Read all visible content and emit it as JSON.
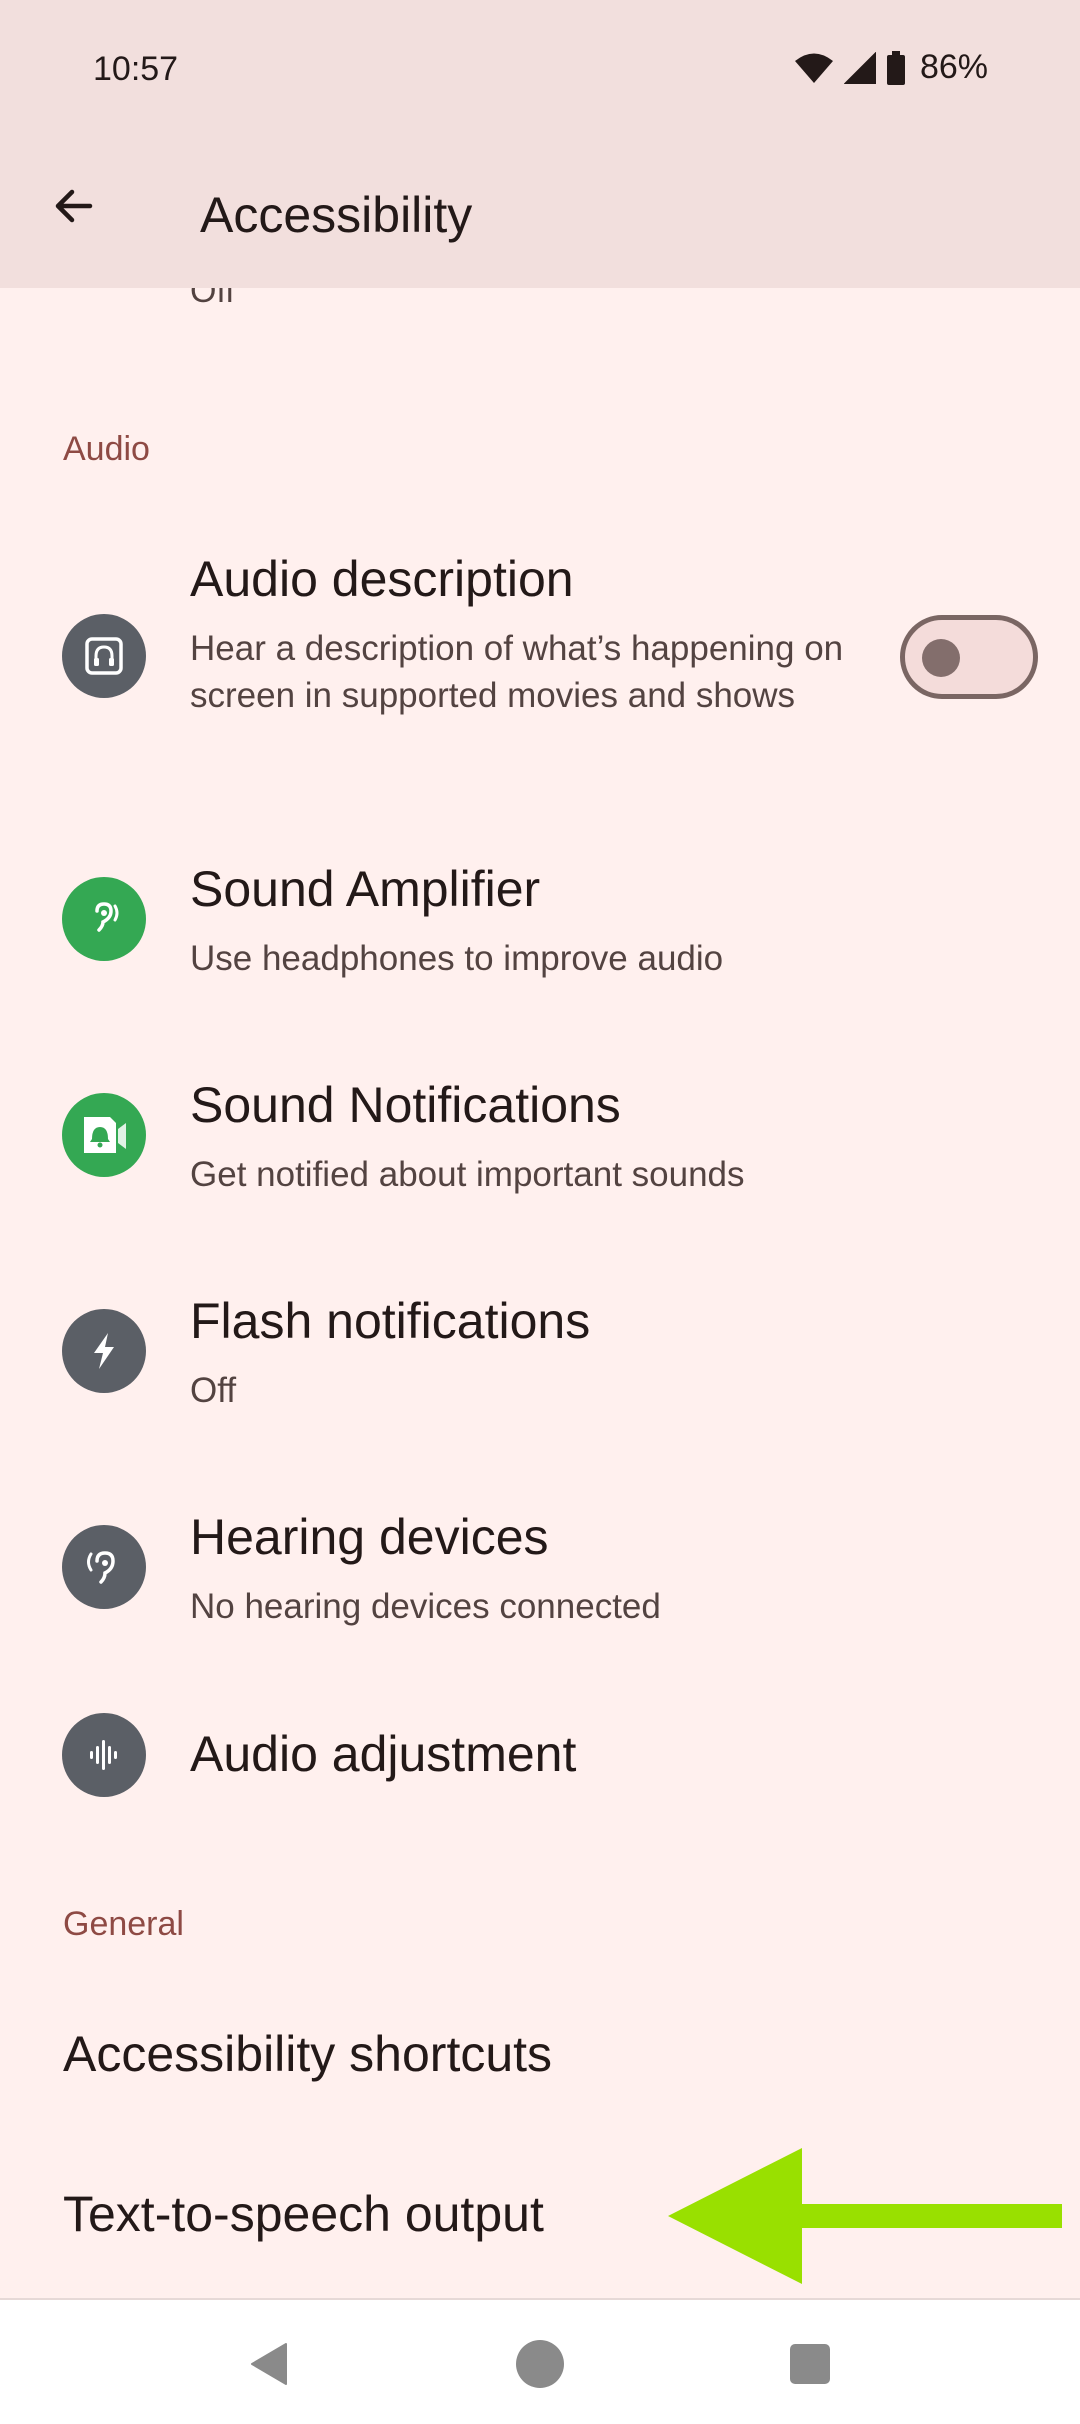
{
  "status_bar": {
    "time": "10:57",
    "battery": "86%",
    "icons": [
      "wifi-icon",
      "signal-icon",
      "battery-icon"
    ]
  },
  "app_bar": {
    "title": "Accessibility",
    "back_icon": "arrow-left-icon"
  },
  "partial_item": {
    "subtitle": "Off"
  },
  "sections": {
    "audio": "Audio",
    "general": "General"
  },
  "audio_items": [
    {
      "title": "Audio description",
      "subtitle": "Hear a description of what’s happening on screen in supported movies and shows",
      "icon": "audio-description-icon",
      "toggle": false
    },
    {
      "title": "Sound Amplifier",
      "subtitle": "Use headphones to improve audio",
      "icon": "sound-amplifier-icon"
    },
    {
      "title": "Sound Notifications",
      "subtitle": "Get notified about important sounds",
      "icon": "sound-notifications-icon"
    },
    {
      "title": "Flash notifications",
      "subtitle": "Off",
      "icon": "flash-icon"
    },
    {
      "title": "Hearing devices",
      "subtitle": "No hearing devices connected",
      "icon": "hearing-icon"
    },
    {
      "title": "Audio adjustment",
      "icon": "waveform-icon"
    }
  ],
  "general_items": [
    {
      "title": "Accessibility shortcuts"
    },
    {
      "title": "Text-to-speech output"
    }
  ],
  "colors": {
    "background": "#fff0ee",
    "app_bar": "#f2dfdd",
    "section_header": "#8e4a44",
    "icon_grey": "#5b5f66",
    "icon_green": "#34a853",
    "arrow": "#99e000"
  }
}
